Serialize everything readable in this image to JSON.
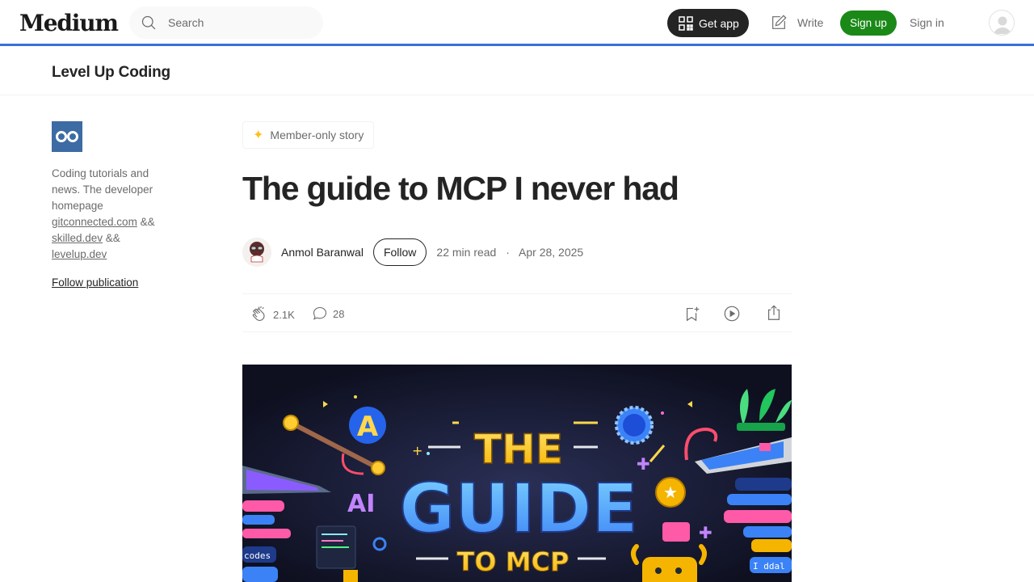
{
  "header": {
    "logo": "Medium",
    "search_placeholder": "Search",
    "get_app": "Get app",
    "write": "Write",
    "sign_up": "Sign up",
    "sign_in": "Sign in"
  },
  "publication": {
    "name": "Level Up Coding",
    "description_prefix": "Coding tutorials and news. The developer homepage",
    "link1": "gitconnected.com",
    "sep1": " &&",
    "link2": "skilled.dev",
    "sep2": " &&",
    "link3": "levelup.dev",
    "follow": "Follow publication"
  },
  "article": {
    "badge": "Member-only story",
    "title": "The guide to MCP I never had",
    "author": "Anmol Baranwal",
    "follow": "Follow",
    "read_time": "22 min read",
    "separator": "·",
    "date": "Apr 28, 2025",
    "claps": "2.1K",
    "responses": "28"
  },
  "hero_image": {
    "line1": "THE",
    "line2": "GUIDE",
    "line3": "TO MCP",
    "badge_a": "A",
    "ai_label": "AI",
    "codes_label": "codes",
    "ddal_label": "I ddal"
  },
  "colors": {
    "accent_blue": "#3a6fd8",
    "sign_up_green": "#1a8917",
    "publication_logo": "#3d6ba3",
    "member_star": "#ffc017"
  }
}
